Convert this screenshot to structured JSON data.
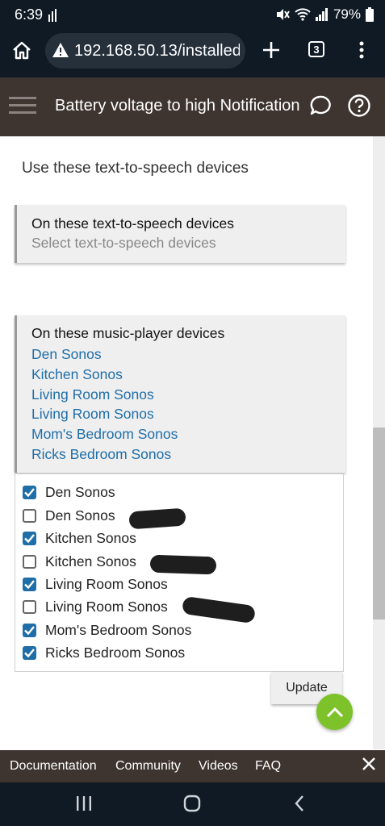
{
  "status_bar": {
    "time": "6:39",
    "battery": "79%",
    "icons": [
      "signal-bars-icon",
      "mute-icon",
      "wifi-icon",
      "cell-signal-icon",
      "battery-icon"
    ]
  },
  "browser": {
    "url": "192.168.50.13/installedapp",
    "tab_count": "3",
    "icons": [
      "home-icon",
      "warning-icon",
      "new-tab-plus-icon",
      "tab-switcher-icon",
      "more-vert-icon"
    ]
  },
  "app_header": {
    "title": "Battery voltage to high Notification",
    "icons": [
      "hamburger-menu-icon",
      "chat-bubble-icon",
      "help-circle-icon"
    ]
  },
  "section_title": "Use these text-to-speech devices",
  "tts_card": {
    "heading": "On these text-to-speech devices",
    "placeholder": "Select text-to-speech devices"
  },
  "music_card": {
    "heading": "On these music-player devices",
    "selected": [
      "Den Sonos",
      "Kitchen Sonos",
      "Living Room Sonos",
      "Living Room Sonos",
      "Mom's Bedroom Sonos",
      "Ricks Bedroom Sonos"
    ]
  },
  "device_options": [
    {
      "label": "Den Sonos",
      "checked": true
    },
    {
      "label": "Den Sonos",
      "checked": false
    },
    {
      "label": "Kitchen Sonos",
      "checked": true
    },
    {
      "label": "Kitchen Sonos",
      "checked": false
    },
    {
      "label": "Living Room Sonos",
      "checked": true
    },
    {
      "label": "Living Room Sonos",
      "checked": false
    },
    {
      "label": "Mom's Bedroom Sonos",
      "checked": true
    },
    {
      "label": "Ricks Bedroom Sonos",
      "checked": true
    }
  ],
  "update_button": "Update",
  "footer": {
    "links": [
      "Documentation",
      "Community",
      "Videos",
      "FAQ"
    ],
    "close_icon": "close-icon"
  },
  "nav_bar": {
    "icons": [
      "recents-icon",
      "home-circle-icon",
      "back-chevron-icon"
    ]
  },
  "colors": {
    "header_bg": "#3e3430",
    "link_blue": "#1f6ea8",
    "checkbox_blue": "#1f6ea8",
    "fab_green": "#7ec22b",
    "system_bar": "#0f1a24"
  }
}
